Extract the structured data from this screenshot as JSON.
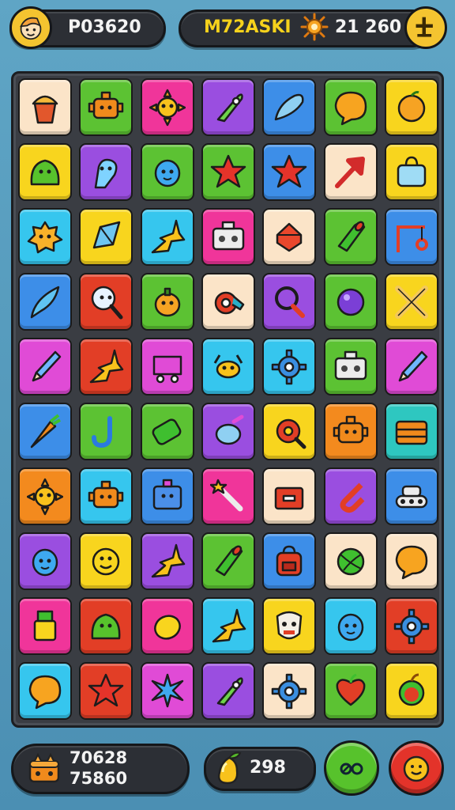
{
  "header": {
    "player_name": "P03620",
    "title": "M72ASKI",
    "score": "21 260"
  },
  "footer": {
    "stat_line_1": "70628",
    "stat_line_2": "75860",
    "fruit_count": "298"
  },
  "colors": {
    "cream": "#fbe4c8",
    "green": "#5cc233",
    "pink": "#f0359a",
    "purple": "#9a4ee0",
    "blue": "#3d8ee8",
    "yellow": "#f8d51e",
    "cyan": "#36c6ee",
    "red": "#e23e26",
    "orange": "#f38a1e",
    "magenta": "#e04bd6",
    "teal": "#2ec7c0"
  },
  "grid": [
    [
      {
        "c": "cream",
        "i": "cupcake-icon"
      },
      {
        "c": "green",
        "i": "robot-icon"
      },
      {
        "c": "pink",
        "i": "sun-icon"
      },
      {
        "c": "purple",
        "i": "rocket-icon"
      },
      {
        "c": "blue",
        "i": "fish-icon"
      },
      {
        "c": "green",
        "i": "speech-bubble-icon"
      },
      {
        "c": "yellow",
        "i": "orange-fruit-icon"
      }
    ],
    [
      {
        "c": "yellow",
        "i": "slime-icon"
      },
      {
        "c": "purple",
        "i": "ghost-icon"
      },
      {
        "c": "green",
        "i": "blob-creature-icon"
      },
      {
        "c": "green",
        "i": "star-icon"
      },
      {
        "c": "blue",
        "i": "star-icon"
      },
      {
        "c": "cream",
        "i": "arrow-icon"
      },
      {
        "c": "yellow",
        "i": "bag-icon"
      }
    ],
    [
      {
        "c": "cyan",
        "i": "spiky-creature-icon"
      },
      {
        "c": "yellow",
        "i": "crystal-icon"
      },
      {
        "c": "cyan",
        "i": "comet-icon"
      },
      {
        "c": "pink",
        "i": "radio-icon"
      },
      {
        "c": "cream",
        "i": "gem-icon"
      },
      {
        "c": "green",
        "i": "cannon-icon"
      },
      {
        "c": "blue",
        "i": "swing-icon"
      }
    ],
    [
      {
        "c": "blue",
        "i": "feather-icon"
      },
      {
        "c": "red",
        "i": "magnifier-creature-icon"
      },
      {
        "c": "green",
        "i": "pumpkin-icon"
      },
      {
        "c": "cream",
        "i": "whistle-icon"
      },
      {
        "c": "purple",
        "i": "mirror-icon"
      },
      {
        "c": "green",
        "i": "orb-icon"
      },
      {
        "c": "yellow",
        "i": "crossed-bones-icon"
      }
    ],
    [
      {
        "c": "magenta",
        "i": "pencil-icon"
      },
      {
        "c": "red",
        "i": "comet-icon"
      },
      {
        "c": "magenta",
        "i": "cart-icon"
      },
      {
        "c": "cyan",
        "i": "crab-icon"
      },
      {
        "c": "cyan",
        "i": "gear-icon"
      },
      {
        "c": "green",
        "i": "radio-icon"
      },
      {
        "c": "magenta",
        "i": "pencil-icon"
      }
    ],
    [
      {
        "c": "blue",
        "i": "carrot-icon"
      },
      {
        "c": "green",
        "i": "hook-icon"
      },
      {
        "c": "green",
        "i": "battery-icon"
      },
      {
        "c": "purple",
        "i": "potion-icon"
      },
      {
        "c": "yellow",
        "i": "donut-icon"
      },
      {
        "c": "orange",
        "i": "robot-icon"
      },
      {
        "c": "teal",
        "i": "chest-icon"
      }
    ],
    [
      {
        "c": "orange",
        "i": "sun-icon"
      },
      {
        "c": "cyan",
        "i": "robot-icon"
      },
      {
        "c": "blue",
        "i": "box-robot-icon"
      },
      {
        "c": "pink",
        "i": "wand-icon"
      },
      {
        "c": "cream",
        "i": "treasure-icon"
      },
      {
        "c": "purple",
        "i": "magnet-icon"
      },
      {
        "c": "blue",
        "i": "tank-icon"
      }
    ],
    [
      {
        "c": "purple",
        "i": "blob-creature-icon"
      },
      {
        "c": "yellow",
        "i": "smiley-icon"
      },
      {
        "c": "purple",
        "i": "comet-icon"
      },
      {
        "c": "green",
        "i": "cannon-icon"
      },
      {
        "c": "blue",
        "i": "backpack-icon"
      },
      {
        "c": "cream",
        "i": "ball-icon"
      },
      {
        "c": "cream",
        "i": "speech-bubble-icon"
      }
    ],
    [
      {
        "c": "pink",
        "i": "potion-jar-icon"
      },
      {
        "c": "red",
        "i": "slime-icon"
      },
      {
        "c": "pink",
        "i": "lemon-icon"
      },
      {
        "c": "cyan",
        "i": "comet-icon"
      },
      {
        "c": "yellow",
        "i": "mask-icon"
      },
      {
        "c": "cyan",
        "i": "blob-creature-icon"
      },
      {
        "c": "red",
        "i": "gear-icon"
      }
    ],
    [
      {
        "c": "cyan",
        "i": "speech-bubble-icon"
      },
      {
        "c": "red",
        "i": "star-icon"
      },
      {
        "c": "magenta",
        "i": "spike-icon"
      },
      {
        "c": "purple",
        "i": "rocket-icon"
      },
      {
        "c": "cream",
        "i": "gear-icon"
      },
      {
        "c": "green",
        "i": "heart-icon"
      },
      {
        "c": "yellow",
        "i": "apple-icon"
      }
    ]
  ]
}
